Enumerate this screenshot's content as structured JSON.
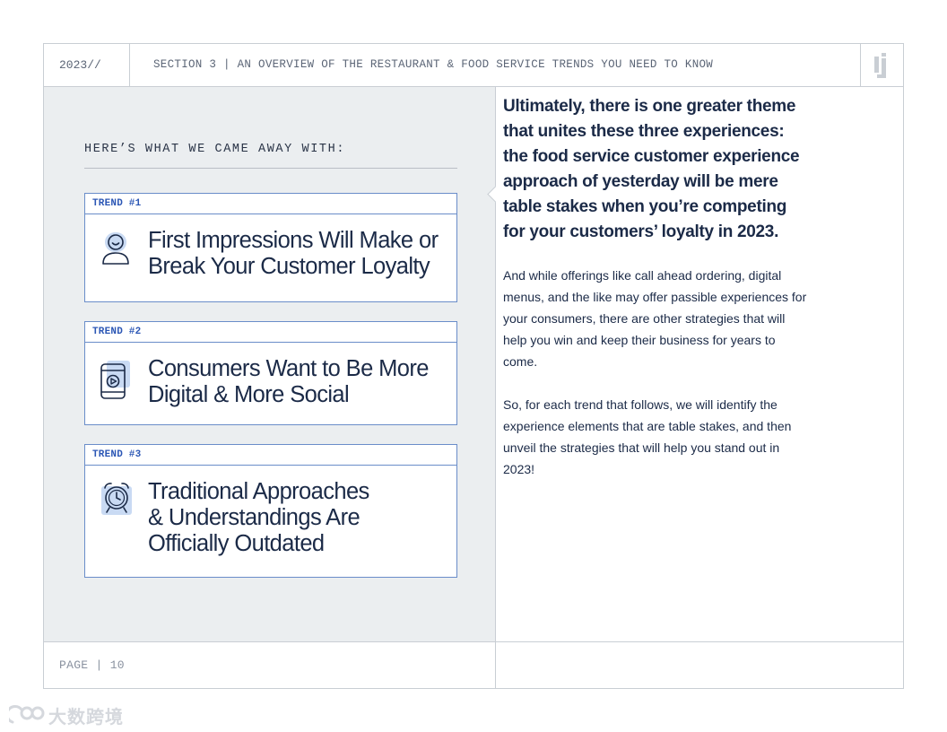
{
  "header": {
    "year": "2023//",
    "section": "SECTION 3 | AN OVERVIEW OF THE RESTAURANT & FOOD SERVICE TRENDS YOU NEED TO KNOW",
    "logo_icon": "brand-logo-icon"
  },
  "left": {
    "intro": "HERE’S WHAT WE CAME AWAY WITH:",
    "trends": [
      {
        "tag": "TREND #1",
        "icon": "person-smile-icon",
        "title_lines": [
          "First Impressions Will Make or",
          "Break Your Customer Loyalty"
        ]
      },
      {
        "tag": "TREND #2",
        "icon": "phone-video-icon",
        "title_lines": [
          "Consumers Want to Be More",
          "Digital & More Social"
        ]
      },
      {
        "tag": "TREND #3",
        "icon": "alarm-clock-icon",
        "title_lines": [
          "Traditional Approaches",
          "& Understandings Are",
          "Officially Outdated"
        ]
      }
    ]
  },
  "right": {
    "lead": "Ultimately, there is one greater theme that unites these three experiences: the food service customer experience approach of yesterday will be mere table stakes when you’re competing for your customers’ loyalty in 2023.",
    "para1": "And while offerings like call ahead ordering, digital menus, and the like may offer passible experiences for your consumers, there are other strategies that will help you win and keep their business for years to come.",
    "para2": "So, for each trend that follows, we will identify the experience elements that are table stakes, and then unveil the strategies that will help you stand out in 2023!"
  },
  "footer": {
    "page": "PAGE | 10"
  },
  "watermark": {
    "text": "大数跨境"
  },
  "colors": {
    "accent": "#2c57b5",
    "card_border": "#6a8dc9",
    "icon_fill": "#c9daf3",
    "text": "#1b2a47",
    "panel_bg": "#ebeef0"
  }
}
